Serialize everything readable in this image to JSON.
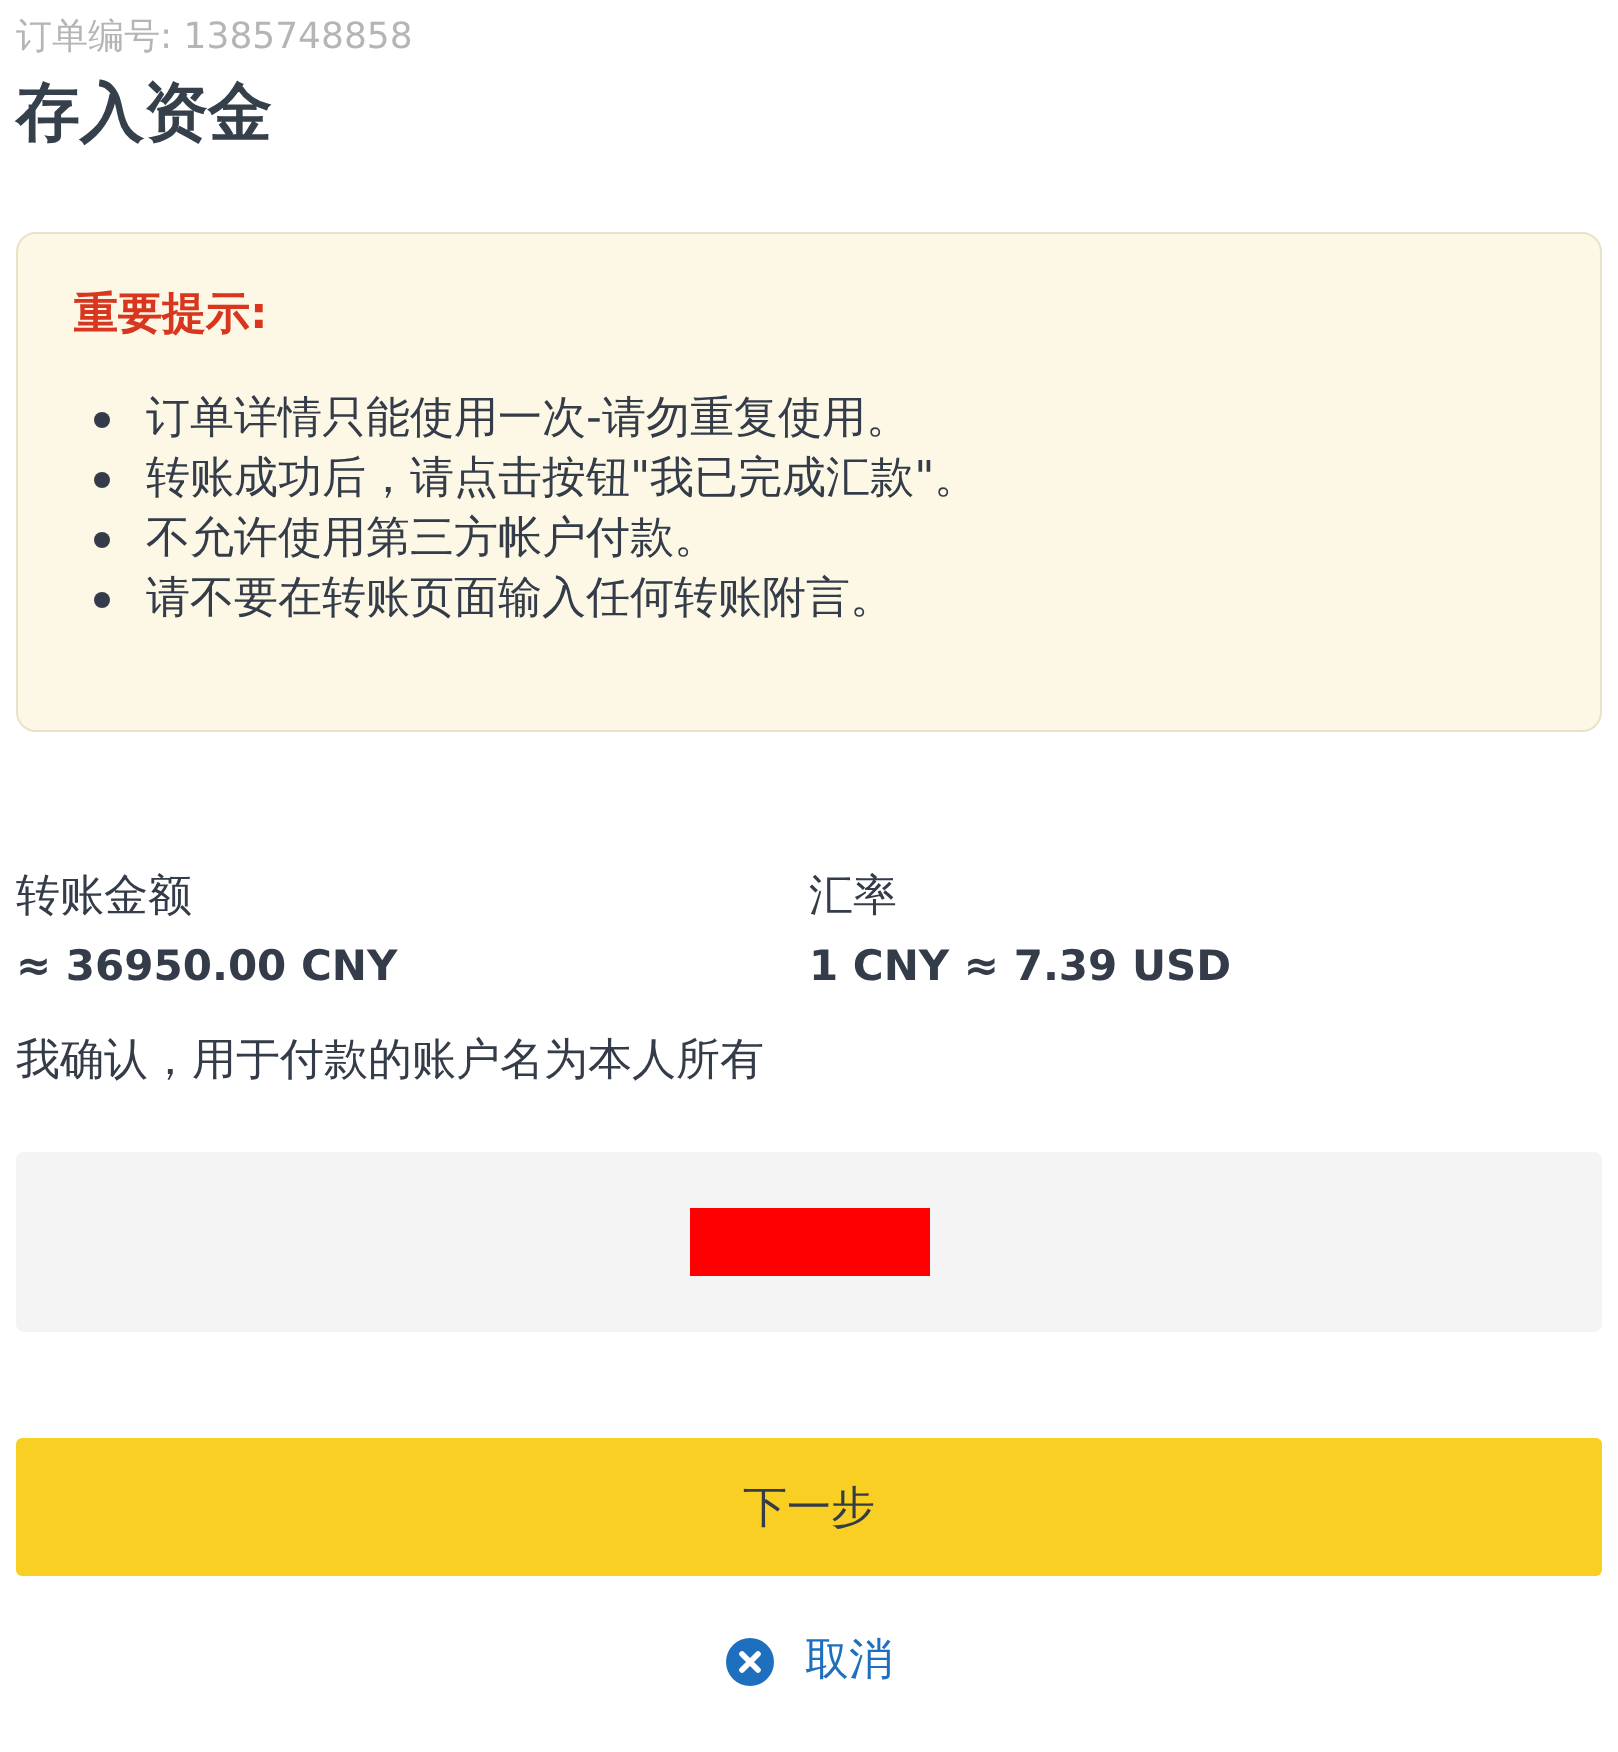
{
  "order_number": "订单编号: 1385748858",
  "title": "存入资金",
  "notice": {
    "heading": "重要提示:",
    "items": [
      "订单详情只能使用一次-请勿重复使用。",
      "转账成功后，请点击按钮\"我已完成汇款\"。",
      "不允许使用第三方帐户付款。",
      "请不要在转账页面输入任何转账附言。"
    ]
  },
  "details": [
    {
      "label": "转账金额",
      "value": "≈ 36950.00 CNY"
    },
    {
      "label": "汇率",
      "value": "1 CNY ≈ 7.39 USD"
    }
  ],
  "confirmation": "我确认，用于付款的账户名为本人所有",
  "next_button": "下一步",
  "cancel_link": "取消"
}
